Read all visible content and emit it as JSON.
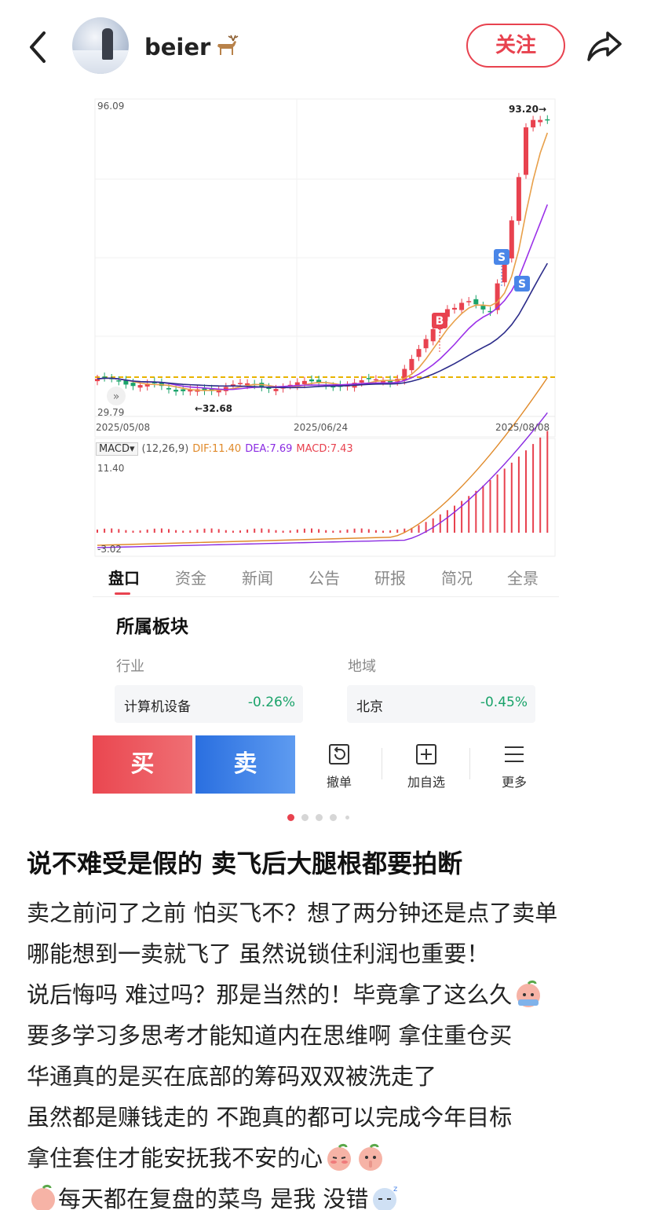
{
  "header": {
    "username": "beier",
    "follow_label": "关注"
  },
  "stock": {
    "chart": {
      "max_label": "96.09",
      "min_label": "29.79",
      "high_marker": "93.20→",
      "low_marker": "←32.68",
      "dates": [
        "2025/05/08",
        "2025/06/24",
        "2025/08/08"
      ],
      "buy_marker": "B",
      "sell_marker": "S",
      "up_color": "#e8424f",
      "down_color": "#1aa36a"
    },
    "macd": {
      "selector": "MACD▾",
      "params": "(12,26,9)",
      "dif": "DIF:11.40",
      "dea": "DEA:7.69",
      "macd": "MACD:7.43",
      "top_label": "11.40",
      "bottom_label": "-3.02"
    },
    "tabs": [
      "盘口",
      "资金",
      "新闻",
      "公告",
      "研报",
      "简况",
      "全景"
    ],
    "sector": {
      "title": "所属板块",
      "industry_label": "行业",
      "region_label": "地域",
      "industry_name": "计算机设备",
      "industry_change": "-0.26%",
      "region_name": "北京",
      "region_change": "-0.45%"
    },
    "trade": {
      "buy": "买",
      "sell": "卖",
      "cancel": "撤单",
      "add_watch": "加自选",
      "more": "更多"
    }
  },
  "carousel": {
    "count": 5,
    "active": 0
  },
  "post": {
    "title": "说不难受是假的 卖飞后大腿根都要拍断",
    "lines": [
      "卖之前问了之前 怕买飞不？想了两分钟还是点了卖单",
      "哪能想到一卖就飞了 虽然说锁住利润也重要！",
      "说后悔吗 难过吗？那是当然的！毕竟拿了这么久",
      "要多学习多思考才能知道内在思维啊 拿住重仓买",
      "华通真的是买在底部的筹码双双被洗走了",
      "虽然都是赚钱走的 不跑真的都可以完成今年目标",
      "拿住套住才能安抚我不安的心",
      "每天都在复盘的菜鸟 是我 没错"
    ]
  }
}
